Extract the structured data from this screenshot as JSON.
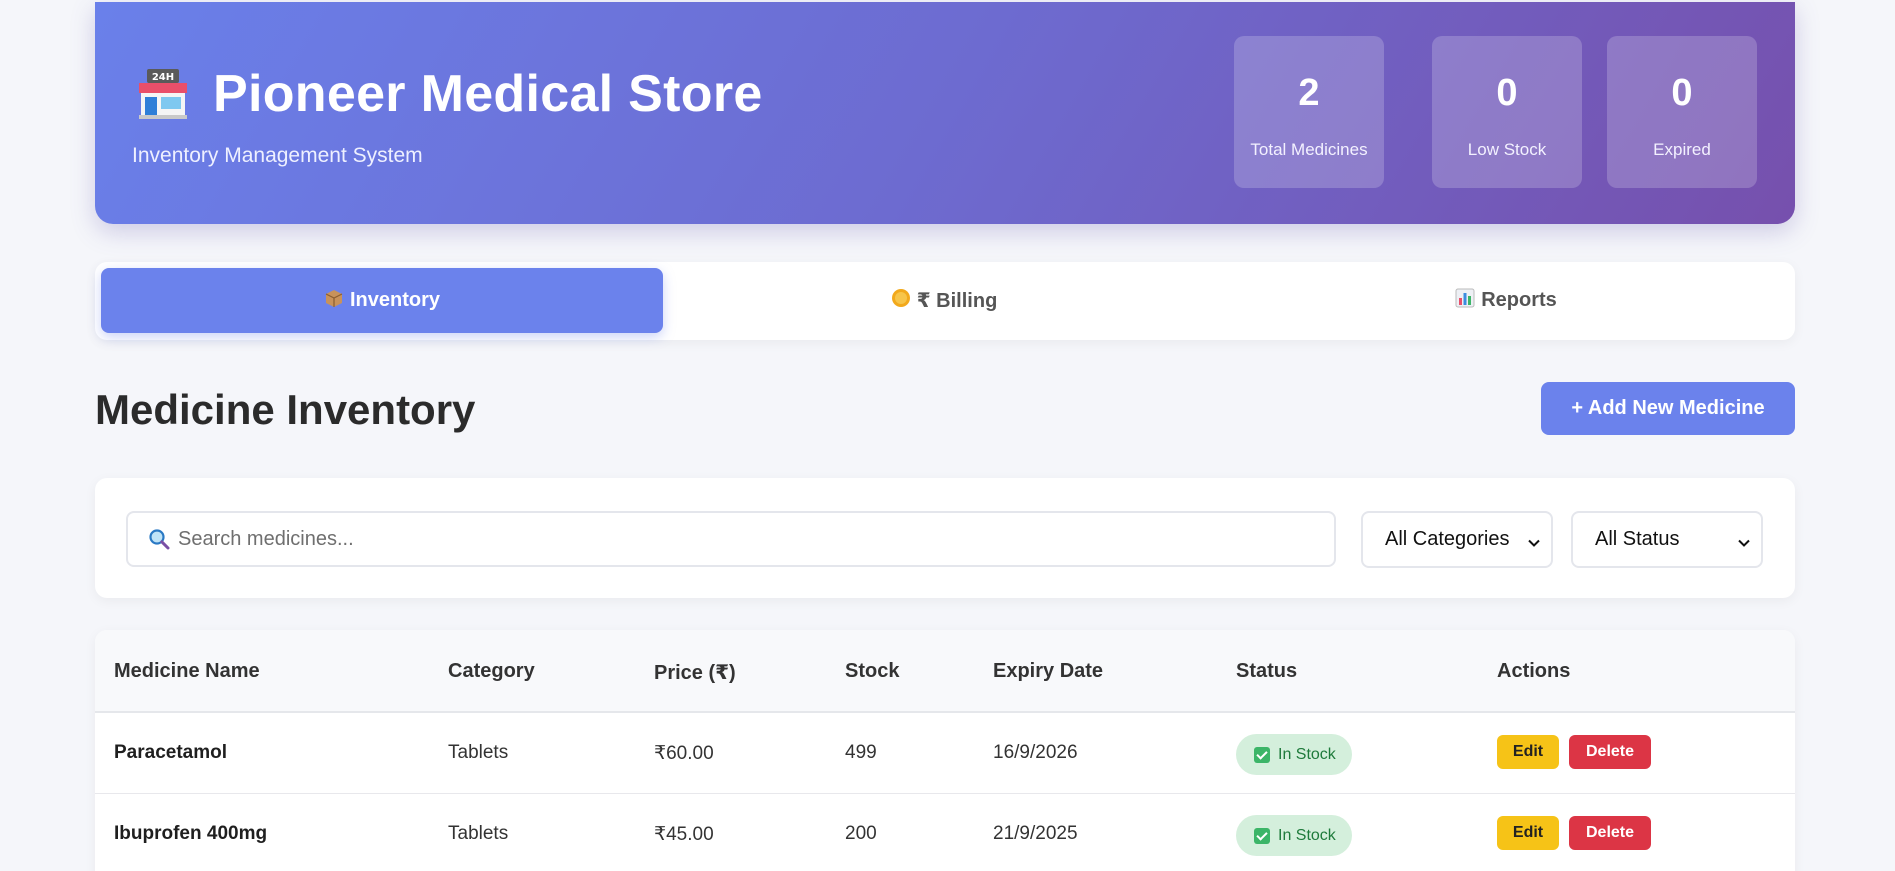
{
  "header": {
    "title": "Pioneer Medical Store",
    "subtitle": "Inventory Management System",
    "stats": [
      {
        "value": "2",
        "label": "Total Medicines"
      },
      {
        "value": "0",
        "label": "Low Stock"
      },
      {
        "value": "0",
        "label": "Expired"
      }
    ],
    "store_icon": "store-24h-icon"
  },
  "tabs": [
    {
      "label": "Inventory",
      "icon": "package-icon",
      "active": true
    },
    {
      "label": "₹ Billing",
      "icon": "coin-icon",
      "active": false
    },
    {
      "label": "Reports",
      "icon": "bar-chart-icon",
      "active": false
    }
  ],
  "section": {
    "title": "Medicine Inventory",
    "add_button": "+ Add New Medicine"
  },
  "filters": {
    "search_placeholder": "Search medicines...",
    "search_value": "",
    "category_selected": "All Categories",
    "status_selected": "All Status"
  },
  "table": {
    "columns": [
      "Medicine Name",
      "Category",
      "Price (₹)",
      "Stock",
      "Expiry Date",
      "Status",
      "Actions"
    ],
    "rows": [
      {
        "name": "Paracetamol",
        "category": "Tablets",
        "price": "₹60.00",
        "stock": "499",
        "expiry": "16/9/2026",
        "status": "In Stock",
        "edit": "Edit",
        "delete": "Delete"
      },
      {
        "name": "Ibuprofen 400mg",
        "category": "Tablets",
        "price": "₹45.00",
        "stock": "200",
        "expiry": "21/9/2025",
        "status": "In Stock",
        "edit": "Edit",
        "delete": "Delete"
      }
    ]
  },
  "colors": {
    "accent": "#6b82ec",
    "header_gradient_start": "#6a80ea",
    "header_gradient_end": "#7650ad",
    "edit": "#f6c317",
    "delete": "#dc3545",
    "in_stock_bg": "#d4efdc",
    "in_stock_text": "#1e7a3b"
  }
}
